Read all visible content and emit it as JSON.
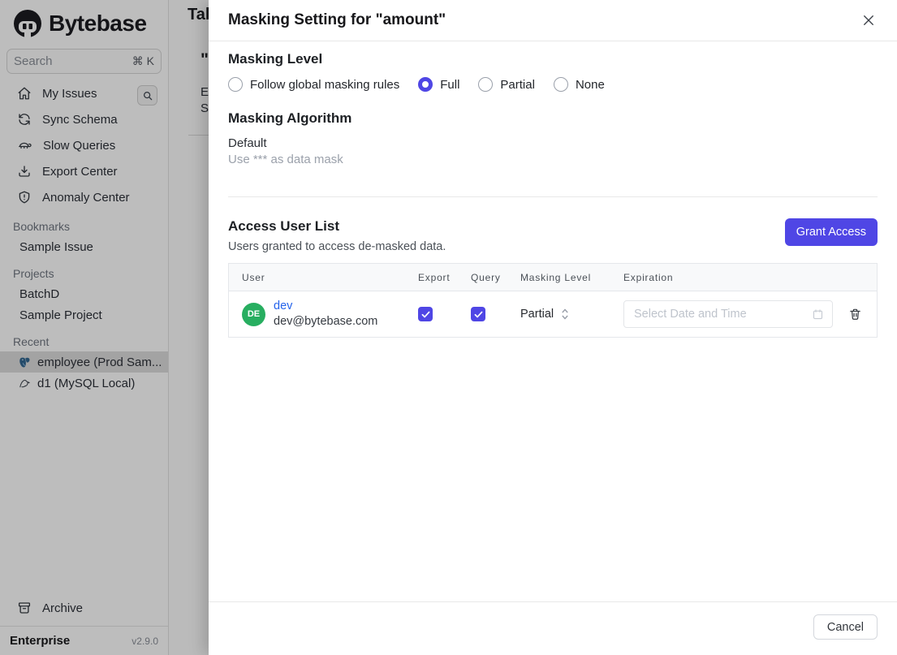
{
  "colors": {
    "accent_indigo": "#4f46e5",
    "link_blue": "#2563eb",
    "avatar_green": "#27ae60",
    "postgres_blue": "#336791"
  },
  "sidebar": {
    "logo_text": "Bytebase",
    "search": {
      "placeholder": "Search",
      "shortcut": "⌘ K"
    },
    "nav": [
      {
        "label": "My Issues"
      },
      {
        "label": "Sync Schema"
      },
      {
        "label": "Slow Queries"
      },
      {
        "label": "Export Center"
      },
      {
        "label": "Anomaly Center"
      }
    ],
    "sections": [
      {
        "title": "Bookmarks",
        "items": [
          {
            "label": "Sample Issue"
          }
        ]
      },
      {
        "title": "Projects",
        "items": [
          {
            "label": "BatchD"
          },
          {
            "label": "Sample Project"
          }
        ]
      },
      {
        "title": "Recent",
        "items": [
          {
            "label": "employee (Prod Sam..."
          },
          {
            "label": "d1 (MySQL Local)"
          }
        ]
      }
    ],
    "archive_label": "Archive",
    "plan": "Enterprise",
    "version": "v2.9.0"
  },
  "background_page": {
    "clipped_title": "Tab",
    "clipped_quote": "\"",
    "clipped_line1": "E",
    "clipped_line2": "S"
  },
  "modal": {
    "title": "Masking Setting for \"amount\"",
    "masking_level": {
      "heading": "Masking Level",
      "options": [
        {
          "label": "Follow global masking rules",
          "selected": false
        },
        {
          "label": "Full",
          "selected": true
        },
        {
          "label": "Partial",
          "selected": false
        },
        {
          "label": "None",
          "selected": false
        }
      ]
    },
    "masking_algorithm": {
      "heading": "Masking Algorithm",
      "name": "Default",
      "description": "Use *** as data mask"
    },
    "access_user_list": {
      "heading": "Access User List",
      "subtitle": "Users granted to access de-masked data.",
      "grant_button": "Grant Access",
      "table": {
        "headers": [
          "User",
          "Export",
          "Query",
          "Masking Level",
          "Expiration"
        ],
        "rows": [
          {
            "avatar_initials": "DE",
            "name": "dev",
            "email": "dev@bytebase.com",
            "export_checked": true,
            "query_checked": true,
            "masking_level": "Partial",
            "expiration_placeholder": "Select Date and Time"
          }
        ]
      }
    },
    "footer": {
      "cancel_label": "Cancel"
    }
  }
}
